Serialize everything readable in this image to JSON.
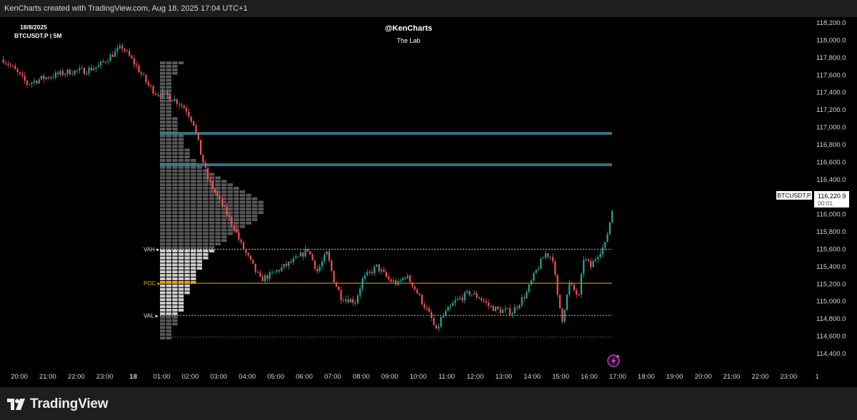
{
  "header": {
    "caption": "KenCharts created with TradingView.com, Aug 18, 2025 17:04 UTC+1"
  },
  "chart_info": {
    "date": "18/8/2025",
    "symbol_line": "BTCUSDT.P | 5M"
  },
  "watermark": {
    "author": "@KenCharts",
    "subtitle": "The Lab"
  },
  "price_badge": {
    "symbol": "BTCUSDT.P",
    "price": "116,220.9",
    "countdown": "00:01"
  },
  "footer": {
    "brand": "TradingView"
  },
  "colors": {
    "up": "#26a69a",
    "down": "#ef5350",
    "poc": "#f7a600",
    "zone": "#2f3a33",
    "level_line": "#3a7f8f",
    "background": "#000000"
  },
  "icons": [
    "tradingview-logo-icon",
    "lightning-icon"
  ],
  "chart_data": {
    "type": "candlestick",
    "title": "",
    "y_ticks": [
      "118,200.0",
      "118,000.0",
      "117,800.0",
      "117,600.0",
      "117,400.0",
      "117,200.0",
      "117,000.0",
      "116,800.0",
      "116,600.0",
      "116,400.0",
      "116,200.0",
      "116,000.0",
      "115,800.0",
      "115,600.0",
      "115,400.0",
      "115,200.0",
      "115,000.0",
      "114,800.0",
      "114,600.0",
      "114,400.0"
    ],
    "x_ticks": [
      "20:00",
      "21:00",
      "22:00",
      "23:00",
      "18",
      "01:00",
      "02:00",
      "03:00",
      "04:00",
      "05:00",
      "06:00",
      "07:00",
      "08:00",
      "09:00",
      "10:00",
      "11:00",
      "12:00",
      "13:00",
      "14:00",
      "15:00",
      "16:00",
      "17:00",
      "18:00",
      "19:00",
      "20:00",
      "21:00",
      "22:00",
      "23:00",
      "1"
    ],
    "ylim": [
      114300,
      118250
    ],
    "grid": false,
    "price_path": [
      [
        "19:40",
        117780
      ],
      [
        "20:00",
        117680
      ],
      [
        "20:30",
        117500
      ],
      [
        "21:00",
        117560
      ],
      [
        "21:30",
        117600
      ],
      [
        "22:00",
        117640
      ],
      [
        "22:30",
        117650
      ],
      [
        "23:00",
        117700
      ],
      [
        "23:30",
        117840
      ],
      [
        "23:50",
        117920
      ],
      [
        "00:20",
        117700
      ],
      [
        "00:45",
        117480
      ],
      [
        "01:00",
        117400
      ],
      [
        "01:30",
        117350
      ],
      [
        "01:50",
        117280
      ],
      [
        "02:05",
        117200
      ],
      [
        "02:20",
        117050
      ],
      [
        "02:35",
        116700
      ],
      [
        "02:50",
        116400
      ],
      [
        "03:15",
        116150
      ],
      [
        "03:30",
        116000
      ],
      [
        "03:45",
        115850
      ],
      [
        "04:00",
        115650
      ],
      [
        "04:20",
        115450
      ],
      [
        "04:40",
        115250
      ],
      [
        "05:00",
        115300
      ],
      [
        "05:30",
        115400
      ],
      [
        "06:00",
        115500
      ],
      [
        "06:20",
        115600
      ],
      [
        "06:40",
        115350
      ],
      [
        "07:00",
        115550
      ],
      [
        "07:15",
        115250
      ],
      [
        "07:30",
        115050
      ],
      [
        "08:00",
        115000
      ],
      [
        "08:15",
        115250
      ],
      [
        "08:45",
        115400
      ],
      [
        "09:10",
        115250
      ],
      [
        "09:30",
        115200
      ],
      [
        "09:45",
        115300
      ],
      [
        "10:00",
        115200
      ],
      [
        "10:20",
        115000
      ],
      [
        "10:40",
        114800
      ],
      [
        "10:50",
        114650
      ],
      [
        "11:00",
        114800
      ],
      [
        "11:30",
        115000
      ],
      [
        "12:00",
        115100
      ],
      [
        "12:20",
        115050
      ],
      [
        "12:40",
        114950
      ],
      [
        "13:00",
        114900
      ],
      [
        "13:30",
        114880
      ],
      [
        "14:00",
        115100
      ],
      [
        "14:20",
        115350
      ],
      [
        "14:40",
        115550
      ],
      [
        "14:55",
        115500
      ],
      [
        "15:05",
        115050
      ],
      [
        "15:15",
        114800
      ],
      [
        "15:30",
        115200
      ],
      [
        "15:50",
        115050
      ],
      [
        "16:00",
        115500
      ],
      [
        "16:15",
        115400
      ],
      [
        "16:30",
        115550
      ],
      [
        "16:45",
        115650
      ],
      [
        "17:00",
        116050
      ],
      [
        "17:04",
        116221
      ]
    ],
    "levels": [
      {
        "label": "",
        "price": 116930
      },
      {
        "label": "",
        "price": 116570
      },
      {
        "label": "VAH",
        "price": 115600
      },
      {
        "label": "POC",
        "price": 115210
      },
      {
        "label": "VAL",
        "price": 114840
      },
      {
        "label": "",
        "price": 114590
      }
    ],
    "zone": {
      "from_time": "15:00",
      "to_time": "19:40",
      "top": 116950,
      "bottom": 114900
    },
    "volume_profile": {
      "low": 114560,
      "high": 117550,
      "step": 40,
      "value_area": [
        114840,
        115600
      ],
      "poc": 115210,
      "widths": [
        2,
        2,
        2,
        2,
        3,
        3,
        3,
        3,
        4,
        4,
        4,
        4,
        4,
        5,
        5,
        5,
        6,
        6,
        6,
        6,
        7,
        7,
        7,
        8,
        8,
        9,
        9,
        10,
        11,
        11,
        12,
        13,
        14,
        15,
        16,
        16,
        17,
        17,
        17,
        17,
        16,
        15,
        14,
        13,
        12,
        11,
        10,
        9,
        8,
        7,
        6,
        6,
        5,
        5,
        5,
        4,
        4,
        4,
        4,
        3,
        3,
        3,
        3,
        3,
        2,
        2,
        2,
        2,
        2,
        2,
        2,
        2,
        2,
        2,
        2,
        2,
        3,
        3,
        3,
        4
      ]
    }
  }
}
